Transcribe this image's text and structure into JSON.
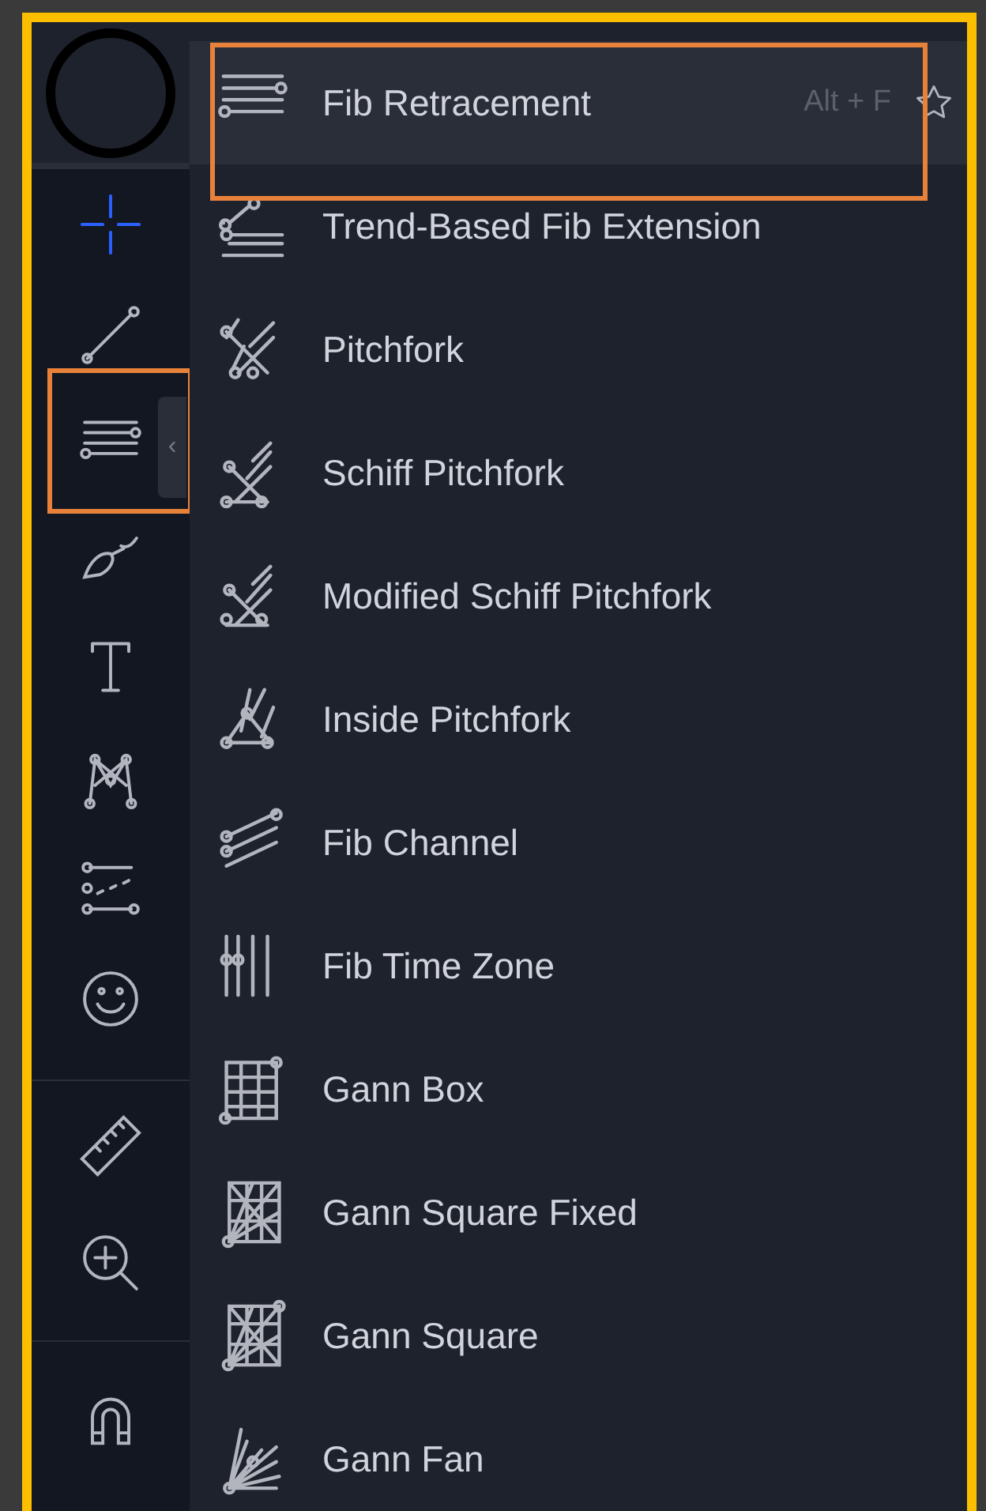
{
  "sidebar": {
    "tools": [
      {
        "kind": "cursor",
        "selected": true
      },
      {
        "kind": "trend-line",
        "selected": false
      },
      {
        "kind": "fib",
        "selected": false,
        "outlined": true,
        "expanded": true,
        "collapse_glyph": "‹"
      },
      {
        "kind": "brush",
        "selected": false
      },
      {
        "kind": "text",
        "selected": false
      },
      {
        "kind": "pattern",
        "selected": false
      },
      {
        "kind": "prediction",
        "selected": false
      },
      {
        "kind": "emoji",
        "selected": false
      },
      {
        "kind": "ruler",
        "selected": false
      },
      {
        "kind": "zoom",
        "selected": false
      },
      {
        "kind": "magnet",
        "selected": false
      }
    ]
  },
  "menu": {
    "items": [
      {
        "label": "Fib Retracement",
        "shortcut": "Alt + F",
        "starred": false,
        "selected": true,
        "outlined": true
      },
      {
        "label": "Trend-Based Fib Extension",
        "selected": false
      },
      {
        "label": "Pitchfork",
        "selected": false
      },
      {
        "label": "Schiff Pitchfork",
        "selected": false
      },
      {
        "label": "Modified Schiff Pitchfork",
        "selected": false
      },
      {
        "label": "Inside Pitchfork",
        "selected": false
      },
      {
        "label": "Fib Channel",
        "selected": false
      },
      {
        "label": "Fib Time Zone",
        "selected": false
      },
      {
        "label": "Gann Box",
        "selected": false
      },
      {
        "label": "Gann Square Fixed",
        "selected": false
      },
      {
        "label": "Gann Square",
        "selected": false
      },
      {
        "label": "Gann Fan",
        "selected": false
      }
    ]
  }
}
